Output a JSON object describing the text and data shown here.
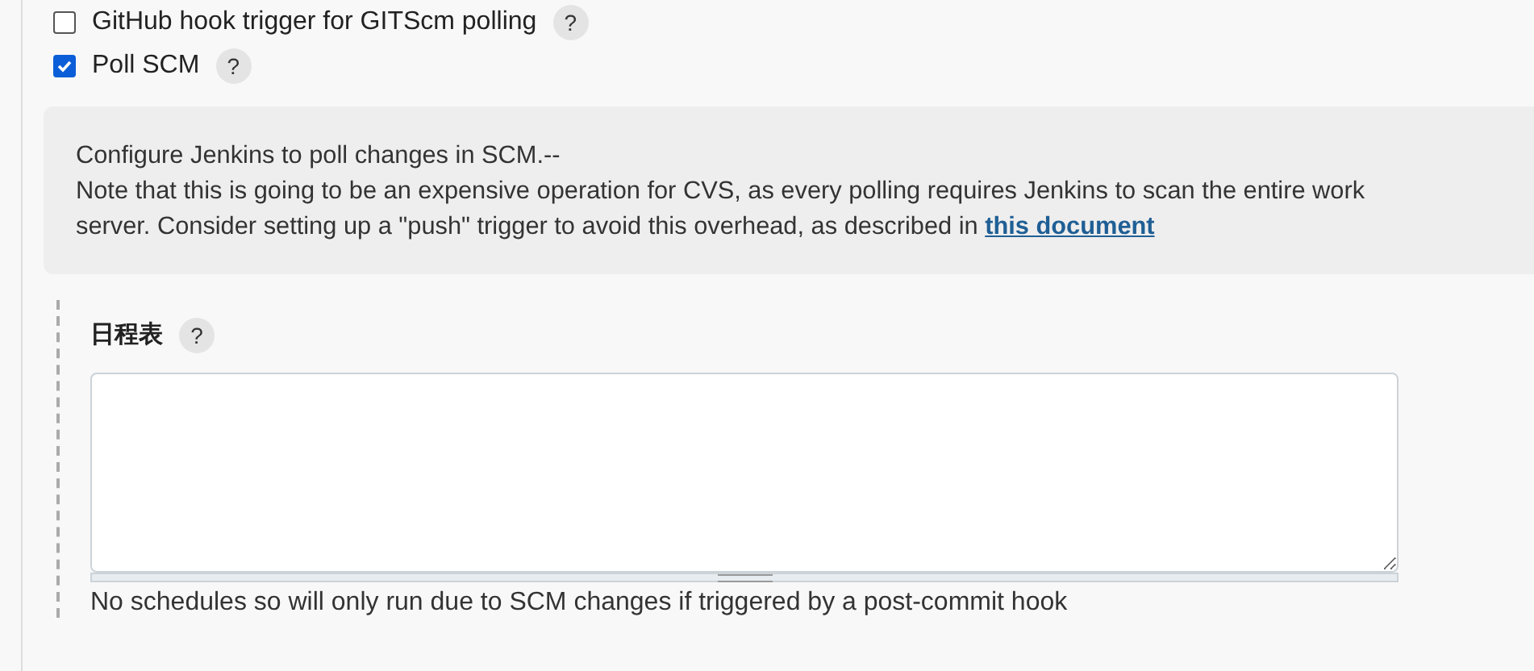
{
  "triggers": [
    {
      "label": "GitHub hook trigger for GITScm polling",
      "checked": false,
      "help": "?"
    },
    {
      "label": "Poll SCM",
      "checked": true,
      "help": "?"
    }
  ],
  "help_box": {
    "lines": [
      "Configure Jenkins to poll changes in SCM.--",
      "Note that this is going to be an expensive operation for CVS, as every polling requires Jenkins to scan the entire work"
    ],
    "last_line": "server. Consider setting up a \"push\" trigger to avoid this overhead, as described in",
    "link": "this document"
  },
  "schedule": {
    "label": "日程表",
    "help": "?",
    "hint": "No schedules so will only run due to SCM changes if triggered by a post-commit hook"
  }
}
